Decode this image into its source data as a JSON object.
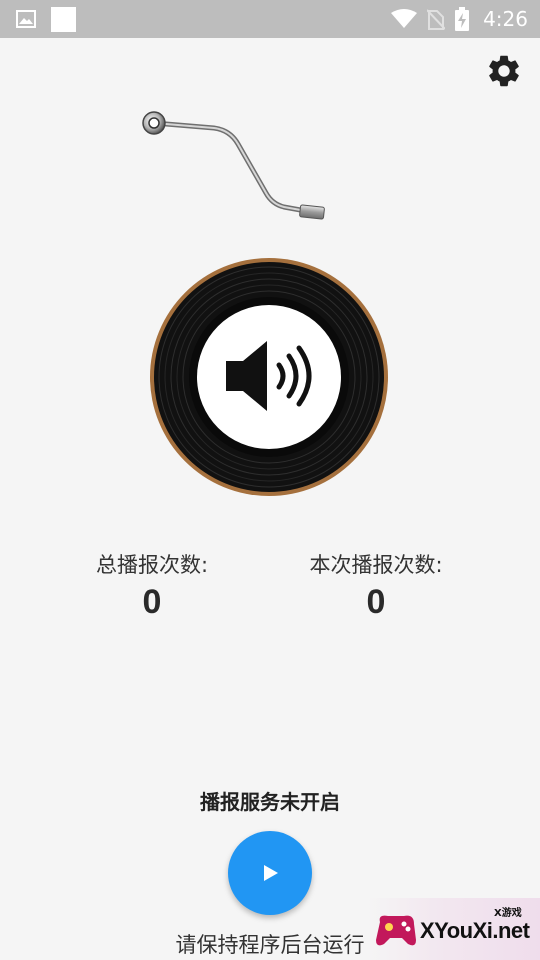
{
  "status_bar": {
    "time": "4:26",
    "icons": [
      "image-icon",
      "app-square-icon",
      "wifi-icon",
      "no-sim-icon",
      "battery-charging-icon"
    ]
  },
  "toolbar": {
    "settings_icon": "gear-icon"
  },
  "player": {
    "record_icon": "speaker-icon",
    "tonearm_icon": "tonearm-icon"
  },
  "stats": {
    "total_label": "总播报次数:",
    "total_value": "0",
    "current_label": "本次播报次数:",
    "current_value": "0"
  },
  "service": {
    "status_text": "播报服务未开启",
    "play_icon": "play-icon",
    "hint_text": "请保持程序后台运行"
  },
  "watermark": {
    "text": "XYouXi.net",
    "small_text": "X游戏"
  },
  "colors": {
    "accent": "#2196f3",
    "background": "#f5f5f5",
    "status_bar": "#bdbdbd",
    "record_rim": "#a5703d"
  }
}
